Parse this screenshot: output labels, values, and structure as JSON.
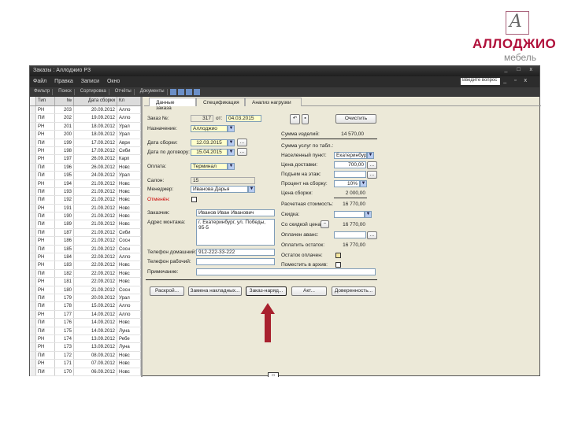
{
  "logo": {
    "brand": "АЛЛОДЖИО",
    "sub": "мебель",
    "mark": "A"
  },
  "window": {
    "title": "Заказы : Аллоджио P3",
    "controls": "_ □ x"
  },
  "menu": {
    "items": [
      "Файл",
      "Правка",
      "Записи",
      "Окно"
    ],
    "find_placeholder": "Введите вопрос",
    "controls": "_ ▫ x"
  },
  "toolbar": {
    "items": [
      "Фильтр",
      "Поиск",
      "Сортировка",
      "Отчёты",
      "Документы"
    ]
  },
  "grid": {
    "headers": [
      "Тип",
      "№",
      "Дата сборки",
      "Кл"
    ],
    "rows": [
      [
        "РН",
        "203",
        "20.09.2012",
        "Алло"
      ],
      [
        "ПИ",
        "202",
        "19.09.2012",
        "Алло"
      ],
      [
        "РН",
        "201",
        "18.09.2012",
        "Урал"
      ],
      [
        "РН",
        "200",
        "18.09.2012",
        "Урал"
      ],
      [
        "ПИ",
        "199",
        "17.09.2012",
        "Аври"
      ],
      [
        "РН",
        "198",
        "17.09.2012",
        "Сиби"
      ],
      [
        "РН",
        "197",
        "26.09.2012",
        "Карп"
      ],
      [
        "ПИ",
        "196",
        "26.09.2012",
        "Новс"
      ],
      [
        "ПИ",
        "195",
        "24.09.2012",
        "Урал"
      ],
      [
        "РН",
        "194",
        "21.09.2012",
        "Новс"
      ],
      [
        "ПИ",
        "193",
        "21.09.2012",
        "Новс"
      ],
      [
        "ПИ",
        "192",
        "21.09.2012",
        "Новс"
      ],
      [
        "РН",
        "191",
        "21.09.2012",
        "Новс"
      ],
      [
        "ПИ",
        "190",
        "21.09.2012",
        "Новс"
      ],
      [
        "ПИ",
        "189",
        "21.09.2012",
        "Новс"
      ],
      [
        "ПИ",
        "187",
        "21.09.2012",
        "Сиби"
      ],
      [
        "РН",
        "186",
        "21.09.2012",
        "Сосн"
      ],
      [
        "ПИ",
        "185",
        "21.09.2012",
        "Сосн"
      ],
      [
        "РН",
        "184",
        "22.09.2012",
        "Алло"
      ],
      [
        "РН",
        "183",
        "22.09.2012",
        "Новс"
      ],
      [
        "ПИ",
        "182",
        "22.09.2012",
        "Новс"
      ],
      [
        "РН",
        "181",
        "22.09.2012",
        "Новс"
      ],
      [
        "РН",
        "180",
        "21.09.2012",
        "Сосн"
      ],
      [
        "ПИ",
        "179",
        "20.09.2012",
        "Урал"
      ],
      [
        "ПИ",
        "178",
        "15.09.2012",
        "Алло"
      ],
      [
        "РН",
        "177",
        "14.09.2012",
        "Алло"
      ],
      [
        "ПИ",
        "176",
        "14.09.2012",
        "Новс"
      ],
      [
        "ПИ",
        "175",
        "14.09.2012",
        "Луна"
      ],
      [
        "РН",
        "174",
        "13.09.2012",
        "Ребе"
      ],
      [
        "РН",
        "173",
        "13.09.2012",
        "Луна"
      ],
      [
        "ПИ",
        "172",
        "08.09.2012",
        "Новс"
      ],
      [
        "РН",
        "171",
        "07.09.2012",
        "Новс"
      ],
      [
        "ПИ",
        "170",
        "06.09.2012",
        "Новс"
      ]
    ]
  },
  "tabs": [
    "Данные заказа",
    "Спецификация",
    "Анализ нагрузки"
  ],
  "form": {
    "order_no_label": "Заказ №:",
    "order_no": "317",
    "from_label": "от:",
    "order_date": "04.03.2015",
    "purpose_label": "Назначение:",
    "purpose": "Аллоджио",
    "assembly_date_label": "Дата сборки:",
    "assembly_date": "12.03.2015",
    "contract_date_label": "Дата по договору:",
    "contract_date": "15.04.2015",
    "payment_label": "Оплата:",
    "payment": "Терминал",
    "salon_label": "Салон:",
    "salon": "15",
    "manager_label": "Менеджер:",
    "manager": "Иванова Дарья",
    "cancel_label": "Отменён:",
    "customer_label": "Заказчик:",
    "customer": "Иванов Иван Иванович",
    "address_label": "Адрес монтажа:",
    "address": "г. Екатеринбург, ул. Победы, 95-5",
    "home_phone_label": "Телефон домашний:",
    "home_phone": "912-222-33-222",
    "work_phone_label": "Телефон рабочий:",
    "note_label": "Примечание:",
    "clear_button": "Очистить",
    "sum_items_label": "Сумма изделий:",
    "sum_items": "14 570,00",
    "sum_services_label": "Сумма услуг по табл.:",
    "city_label": "Населенный пункт:",
    "city": "Екатеринбург",
    "delivery_label": "Цена доставки:",
    "delivery": "700,00",
    "lift_label": "Подъем на этаж:",
    "assembly_pct_label": "Процент на сборку:",
    "assembly_pct": "10%",
    "assembly_price_label": "Цена сборки:",
    "assembly_price": "2 000,00",
    "estimated_label": "Расчетная стоимость:",
    "estimated": "16 770,00",
    "discount_label": "Скидка:",
    "total_label": "Со скидкой цена:",
    "total": "16 770,00",
    "paid_label": "Оплачен аванс:",
    "remain_label": "Оплатить остаток:",
    "remain": "16 770,00",
    "remain_paid_label": "Остаток оплачен:",
    "archive_label": "Поместить в архив:",
    "dots": "...",
    "minus": "−"
  },
  "buttons": [
    "Раскрой...",
    "Замена накладных...",
    "Заказ-наряд...",
    "Акт...",
    "Доверенность..."
  ],
  "footer_tab": "▭"
}
